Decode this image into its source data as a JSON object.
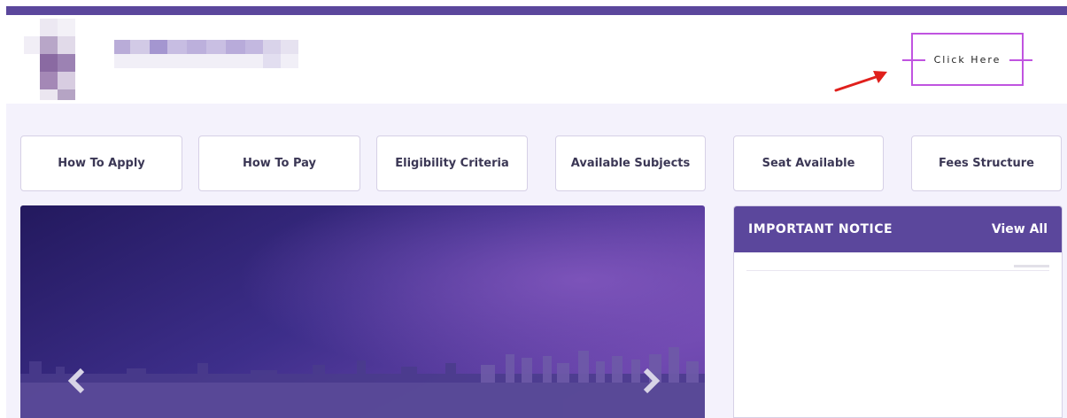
{
  "colors": {
    "brand_purple": "#5b479c",
    "cta_border": "#c054e0",
    "arrow_red": "#e0201c",
    "page_bg": "#f4f2fc",
    "nav_text": "#3b3755"
  },
  "header": {
    "cta_label": "Click Here"
  },
  "nav": {
    "items": [
      {
        "label": "How To Apply"
      },
      {
        "label": "How To Pay"
      },
      {
        "label": "Eligibility Criteria"
      },
      {
        "label": "Available Subjects"
      },
      {
        "label": "Seat Available"
      },
      {
        "label": "Fees Structure"
      }
    ]
  },
  "slider": {
    "prev_icon": "chevron-left-icon",
    "next_icon": "chevron-right-icon"
  },
  "notice": {
    "title": "IMPORTANT NOTICE",
    "view_all_label": "View All"
  }
}
